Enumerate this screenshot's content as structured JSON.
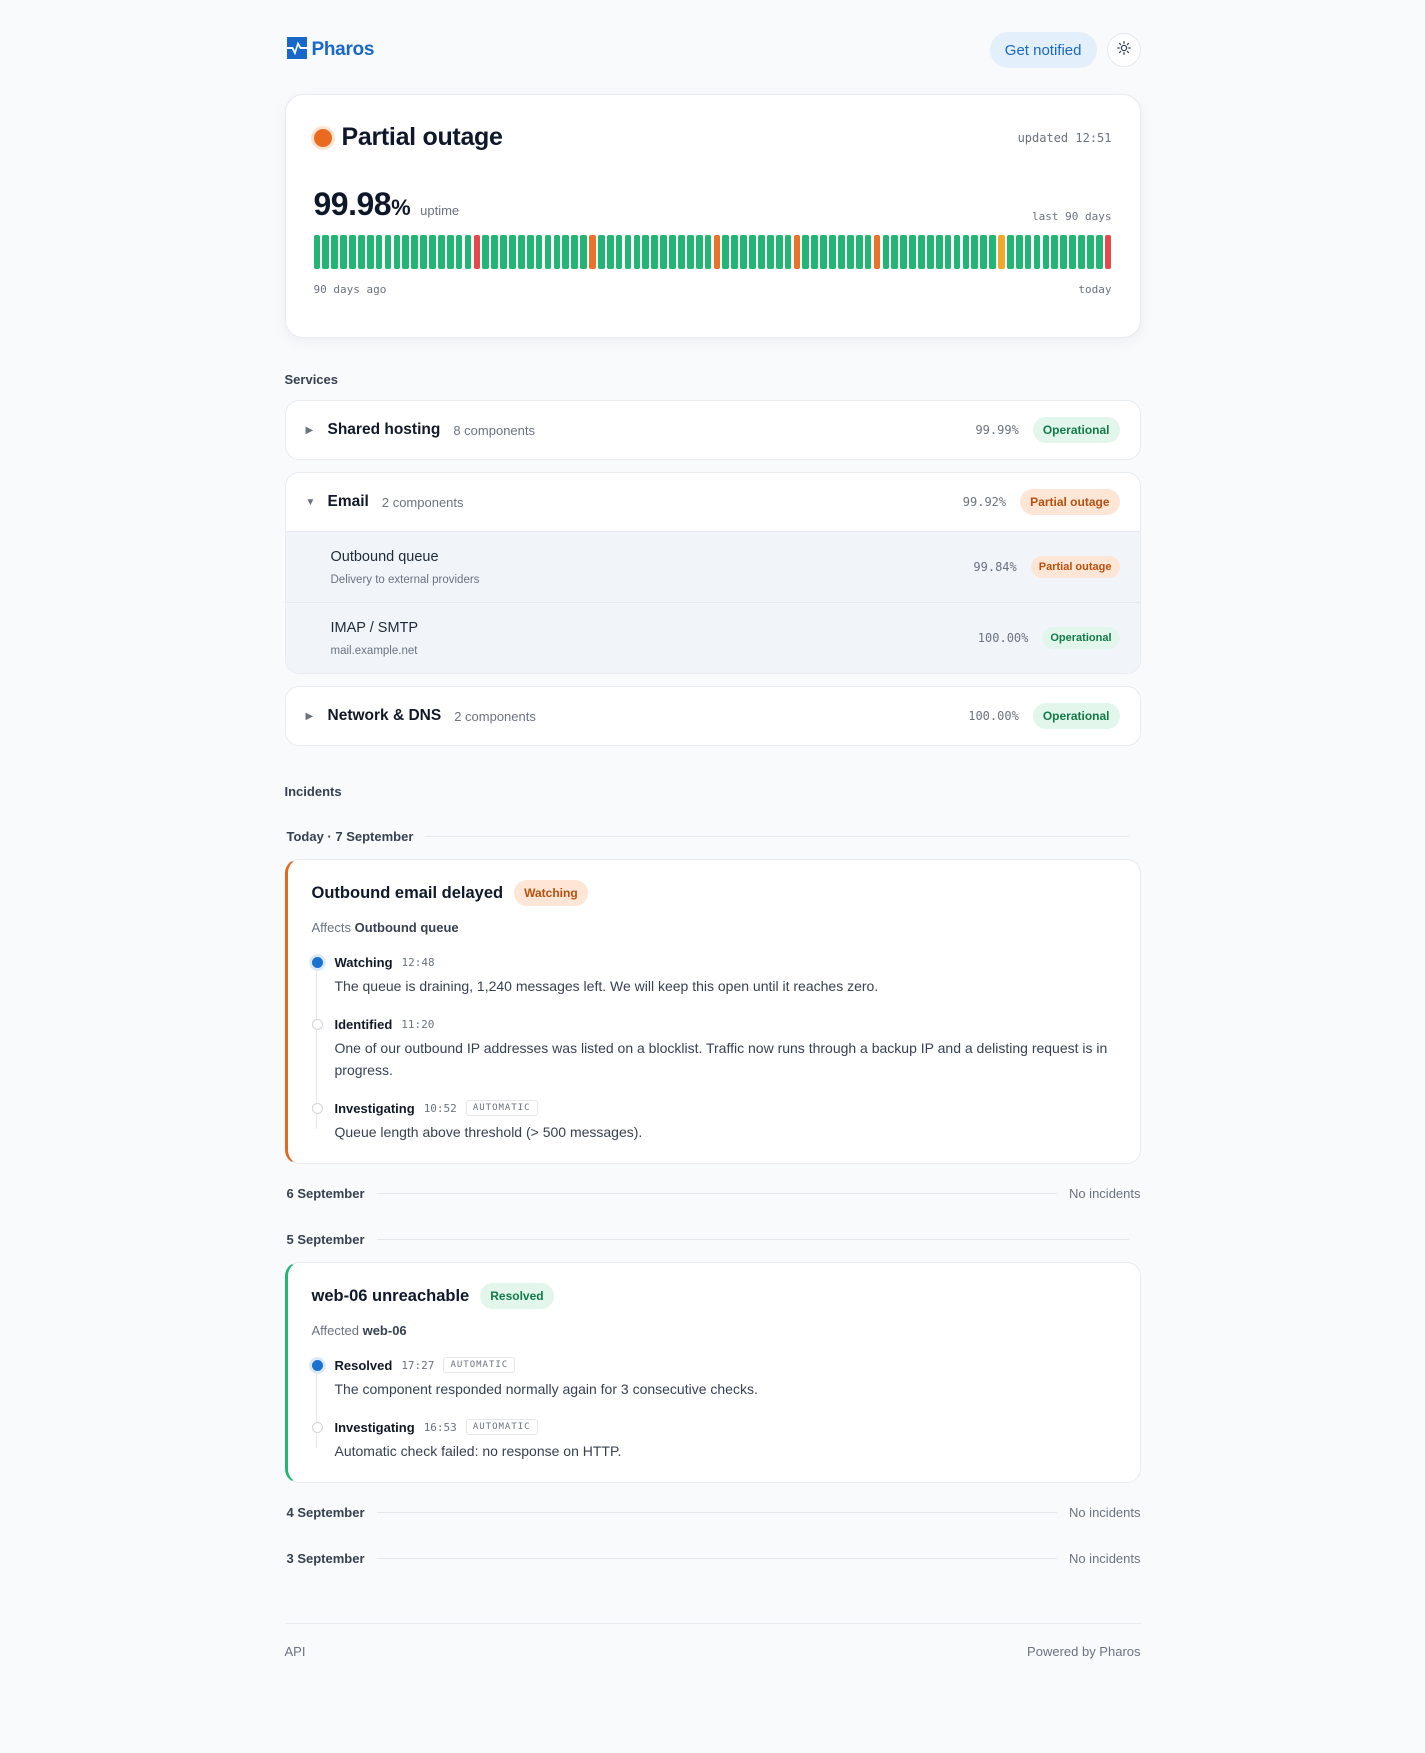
{
  "brand": {
    "name": "Pharos",
    "logo_icon": "pharos-pulse-logo",
    "color": "#1768c8"
  },
  "header": {
    "notify_label": "Get notified",
    "theme_icon": "sun-icon"
  },
  "status": {
    "title": "Partial outage",
    "updated": "updated 12:51",
    "uptime_value": "99.98",
    "uptime_unit": "%",
    "uptime_label": "uptime",
    "range_label": "last 90 days",
    "start_label": "90 days ago",
    "end_label": "today",
    "colors": {
      "ok": "#22b573",
      "partial": "#e8732a",
      "major": "#e5484d",
      "minor": "#f0a92c"
    },
    "history": "ooooooooooooooooooMoooooooooooooooooooooooooooooPoooooooooooooooooPoooooooooooooooooPooooooooooooooPoooooooooooooooooMoooooooooooooooooooooooooooooooooooooooooooooooooooooooooooooooooooooooooooooooooooooooooooooooooooooooooooooooooooooooooooo"
  },
  "sections": {
    "services": "Services",
    "incidents": "Incidents"
  },
  "services": [
    {
      "name": "Shared hosting",
      "count": "8 components",
      "uptime": "99.99%",
      "status": "Operational"
    },
    {
      "name": "Email",
      "count": "2 components",
      "uptime": "99.92%",
      "status": "Partial outage",
      "components": [
        {
          "name": "Outbound queue",
          "desc": "Delivery to external providers",
          "uptime": "99.84%",
          "status": "Partial outage"
        },
        {
          "name": "IMAP / SMTP",
          "desc": "mail.example.net",
          "uptime": "100.00%",
          "status": "Operational"
        }
      ]
    },
    {
      "name": "Network & DNS",
      "count": "2 components",
      "uptime": "100.00%",
      "status": "Operational"
    }
  ],
  "days": {
    "d7": {
      "label": "Today · 7 September"
    },
    "d6": {
      "label": "6 September",
      "note": "No incidents"
    },
    "d5": {
      "label": "5 September"
    },
    "d4": {
      "label": "4 September",
      "note": "No incidents"
    },
    "d3": {
      "label": "3 September",
      "note": "No incidents"
    }
  },
  "incidents": [
    {
      "title": "Outbound email delayed",
      "badge": "Watching",
      "affects_label": "Affects",
      "affects": "Outbound queue",
      "updates": [
        {
          "status": "Watching",
          "time": "12:48",
          "auto": "",
          "body": "The queue is draining, 1,240 messages left. We will keep this open until it reaches zero."
        },
        {
          "status": "Identified",
          "time": "11:20",
          "auto": "",
          "body": "One of our outbound IP addresses was listed on a blocklist. Traffic now runs through a backup IP and a delisting request is in progress."
        },
        {
          "status": "Investigating",
          "time": "10:52",
          "auto": "AUTOMATIC",
          "body": "Queue length above threshold (> 500 messages)."
        }
      ]
    },
    {
      "title": "web-06 unreachable",
      "badge": "Resolved",
      "affects_label": "Affected",
      "affects": "web-06",
      "updates": [
        {
          "status": "Resolved",
          "time": "17:27",
          "auto": "AUTOMATIC",
          "body": "The component responded normally again for 3 consecutive checks."
        },
        {
          "status": "Investigating",
          "time": "16:53",
          "auto": "AUTOMATIC",
          "body": "Automatic check failed: no response on HTTP."
        }
      ]
    }
  ],
  "footer": {
    "api": "API",
    "powered": "Powered by Pharos"
  }
}
